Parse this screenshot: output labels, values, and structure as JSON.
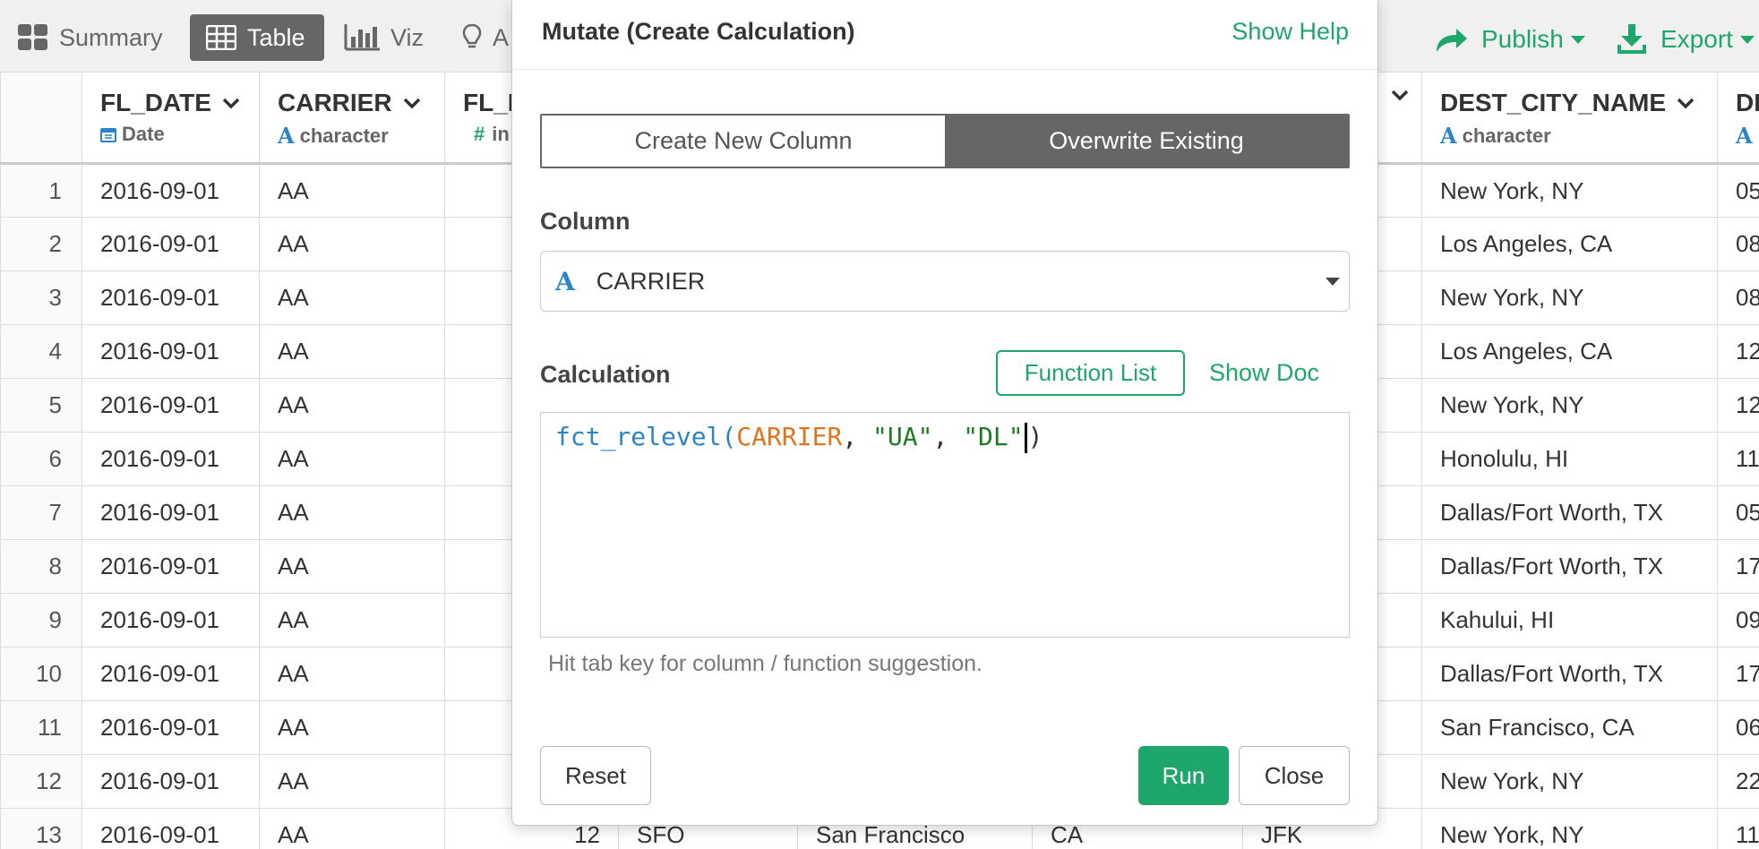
{
  "toolbar": {
    "summary": "Summary",
    "table": "Table",
    "viz": "Viz",
    "analytics": "A",
    "publish": "Publish",
    "export": "Export"
  },
  "table": {
    "columns": [
      {
        "name": "FL_DATE",
        "type": "Date",
        "type_icon": "calendar-icon"
      },
      {
        "name": "CARRIER",
        "type": "character",
        "type_icon": "character-type-icon"
      },
      {
        "name": "FL_N",
        "type": "in",
        "type_icon": "number-type-icon"
      },
      {
        "name": "DEST_CITY_NAME",
        "type": "character",
        "type_icon": "character-type-icon"
      },
      {
        "name": "DI",
        "type": "",
        "type_icon": "character-type-icon"
      }
    ],
    "rows": [
      {
        "n": "1",
        "date": "2016-09-01",
        "carrier": "AA",
        "fln": "",
        "orig": "",
        "origcity": "",
        "state": "",
        "dest": "",
        "destcity": "New York, NY",
        "last": "05"
      },
      {
        "n": "2",
        "date": "2016-09-01",
        "carrier": "AA",
        "fln": "",
        "orig": "",
        "origcity": "",
        "state": "",
        "dest": "",
        "destcity": "Los Angeles, CA",
        "last": "08"
      },
      {
        "n": "3",
        "date": "2016-09-01",
        "carrier": "AA",
        "fln": "",
        "orig": "",
        "origcity": "",
        "state": "",
        "dest": "",
        "destcity": "New York, NY",
        "last": "08"
      },
      {
        "n": "4",
        "date": "2016-09-01",
        "carrier": "AA",
        "fln": "",
        "orig": "",
        "origcity": "",
        "state": "",
        "dest": "",
        "destcity": "Los Angeles, CA",
        "last": "12"
      },
      {
        "n": "5",
        "date": "2016-09-01",
        "carrier": "AA",
        "fln": "",
        "orig": "",
        "origcity": "",
        "state": "",
        "dest": "",
        "destcity": "New York, NY",
        "last": "12"
      },
      {
        "n": "6",
        "date": "2016-09-01",
        "carrier": "AA",
        "fln": "",
        "orig": "",
        "origcity": "",
        "state": "",
        "dest": "",
        "destcity": "Honolulu, HI",
        "last": "11"
      },
      {
        "n": "7",
        "date": "2016-09-01",
        "carrier": "AA",
        "fln": "",
        "orig": "",
        "origcity": "",
        "state": "",
        "dest": "",
        "destcity": "Dallas/Fort Worth, TX",
        "last": "05"
      },
      {
        "n": "8",
        "date": "2016-09-01",
        "carrier": "AA",
        "fln": "",
        "orig": "",
        "origcity": "",
        "state": "",
        "dest": "",
        "destcity": "Dallas/Fort Worth, TX",
        "last": "17"
      },
      {
        "n": "9",
        "date": "2016-09-01",
        "carrier": "AA",
        "fln": "",
        "orig": "",
        "origcity": "",
        "state": "",
        "dest": "",
        "destcity": "Kahului, HI",
        "last": "09"
      },
      {
        "n": "10",
        "date": "2016-09-01",
        "carrier": "AA",
        "fln": "",
        "orig": "",
        "origcity": "",
        "state": "",
        "dest": "",
        "destcity": "Dallas/Fort Worth, TX",
        "last": "17"
      },
      {
        "n": "11",
        "date": "2016-09-01",
        "carrier": "AA",
        "fln": "",
        "orig": "",
        "origcity": "",
        "state": "",
        "dest": "",
        "destcity": "San Francisco, CA",
        "last": "06"
      },
      {
        "n": "12",
        "date": "2016-09-01",
        "carrier": "AA",
        "fln": "",
        "orig": "",
        "origcity": "",
        "state": "",
        "dest": "",
        "destcity": "New York, NY",
        "last": "22"
      },
      {
        "n": "13",
        "date": "2016-09-01",
        "carrier": "AA",
        "fln": "12",
        "orig": "SFO",
        "origcity": "San Francisco",
        "state": "CA",
        "dest": "JFK",
        "destcity": "New York, NY",
        "last": "11"
      }
    ]
  },
  "modal": {
    "title": "Mutate (Create Calculation)",
    "show_help": "Show Help",
    "tab_new": "Create New Column",
    "tab_overwrite": "Overwrite Existing",
    "column_label": "Column",
    "column_value": "CARRIER",
    "calc_label": "Calculation",
    "function_list": "Function List",
    "show_doc": "Show Doc",
    "code": {
      "fn": "fct_relevel",
      "open": "(",
      "col": "CARRIER",
      "sep1": ", ",
      "s1": "\"UA\"",
      "sep2": ", ",
      "s2": "\"DL\"",
      "close": ")"
    },
    "hint": "Hit tab key for column / function suggestion.",
    "reset": "Reset",
    "run": "Run",
    "close": "Close"
  },
  "colors": {
    "accent": "#1fa66b",
    "type_blue": "#2a84c7",
    "code_orange": "#e3741d",
    "code_string": "#1d7d22",
    "active_tab": "#666666"
  }
}
